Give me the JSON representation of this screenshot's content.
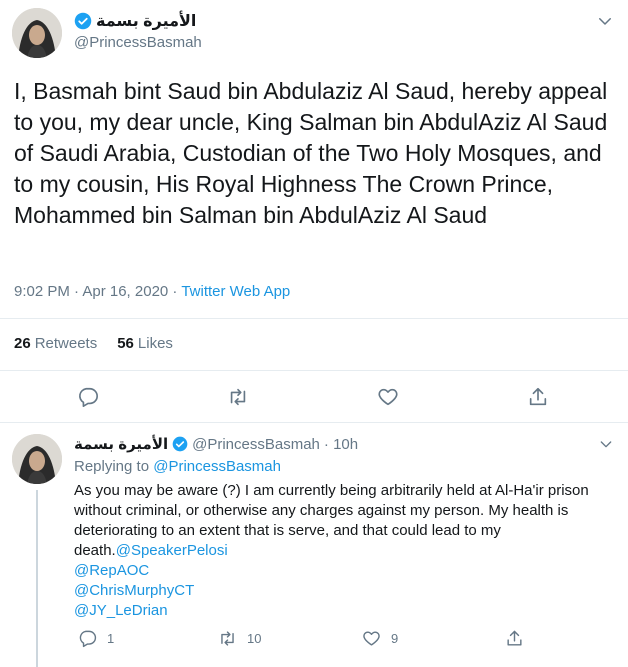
{
  "tweet": {
    "display_name": "الأميرة بسمة",
    "handle": "@PrincessBasmah",
    "text": "I, Basmah bint Saud bin Abdulaziz Al Saud, hereby appeal to you, my dear uncle, King Salman bin AbdulAziz Al Saud of Saudi Arabia, Custodian of the Two Holy Mosques, and to my cousin, His Royal Highness The Crown Prince, Mohammed bin Salman bin AbdulAziz Al Saud",
    "time": "9:02 PM · Apr 16, 2020 · ",
    "source": "Twitter Web App",
    "retweets_count": "26",
    "retweets_label": "Retweets",
    "likes_count": "56",
    "likes_label": "Likes"
  },
  "reply": {
    "display_name": "الأميرة بسمة",
    "handle": "@PrincessBasmah",
    "age": "· 10h",
    "replying_to_label": "Replying to",
    "replying_to_handle": "@PrincessBasmah",
    "text": "As you may be aware (?) I am currently being arbitrarily held at Al-Ha'ir prison without criminal, or otherwise any charges against my person. My health is deteriorating to an extent that is serve, and that could lead to my death.",
    "mentions": [
      "@SpeakerPelosi",
      "@RepAOC",
      "@ChrisMurphyCT",
      "@JY_LeDrian"
    ],
    "reply_count": "1",
    "retweet_count": "10",
    "like_count": "9"
  },
  "colors": {
    "accent": "#1b95e0",
    "verified": "#1da1f2",
    "muted": "#657786",
    "divider": "#e6ecf0"
  },
  "icons": [
    "verified-badge-icon",
    "chevron-down-icon",
    "reply-icon",
    "retweet-icon",
    "like-icon",
    "share-icon"
  ]
}
